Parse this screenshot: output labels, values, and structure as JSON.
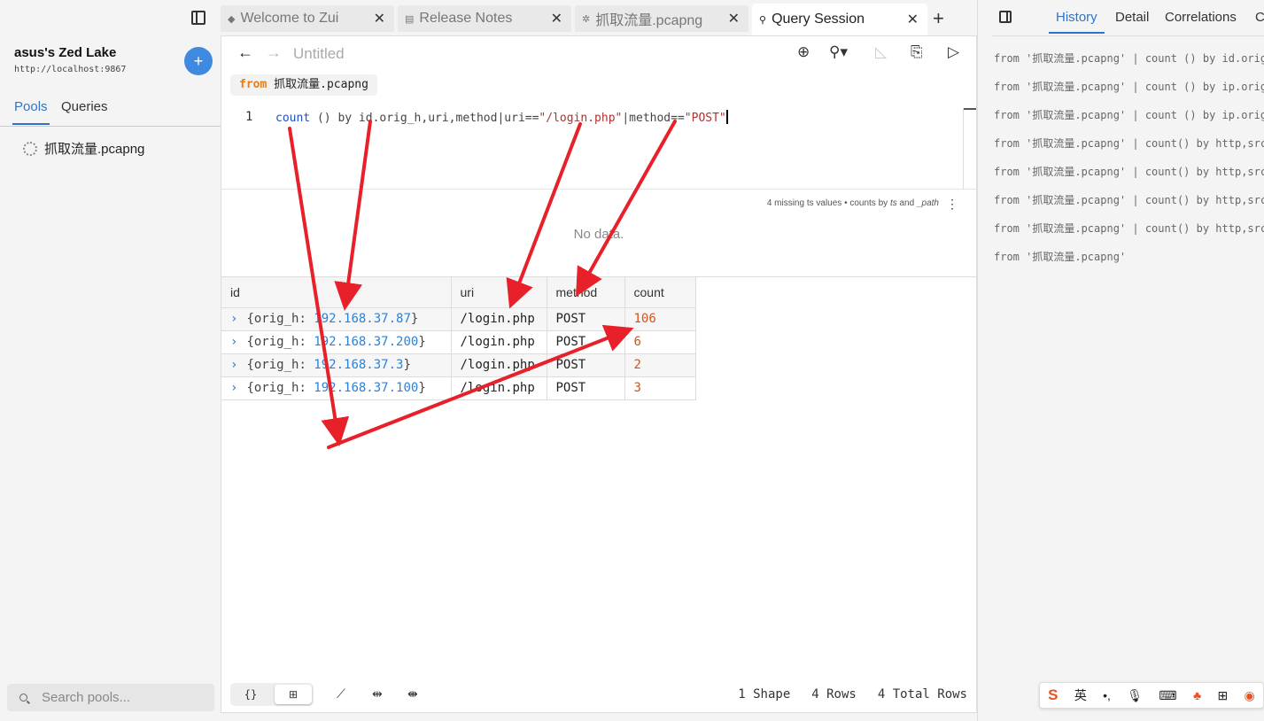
{
  "sidebar": {
    "lake_name": "asus's Zed Lake",
    "lake_url": "http://localhost:9867",
    "add_label": "+",
    "tabs": [
      "Pools",
      "Queries"
    ],
    "pools": [
      "抓取流量.pcapng"
    ],
    "search_placeholder": "Search pools..."
  },
  "tabs": [
    {
      "icon": "◆",
      "label": "Welcome to Zui"
    },
    {
      "icon": "▤",
      "label": "Release Notes"
    },
    {
      "icon": "✲",
      "label": "抓取流量.pcapng"
    },
    {
      "icon": "⚲",
      "label": "Query Session",
      "active": true
    }
  ],
  "query": {
    "title": "Untitled",
    "from_keyword": "from",
    "from_pool": "抓取流量.pcapng",
    "line_number": "1",
    "code_fn": "count",
    "code_mid": " () by id.orig_h,uri,method|uri==",
    "code_str1": "\"/login.php\"",
    "code_mid2": "|method==",
    "code_str2": "\"POST\""
  },
  "chart": {
    "info_prefix": "4 missing ts values • counts by ",
    "info_ts": "ts",
    "info_and": " and ",
    "info_path": "_path",
    "empty_text": "No data."
  },
  "table": {
    "columns": [
      "id",
      "uri",
      "method",
      "count"
    ],
    "rows": [
      {
        "prefix": "{orig_h: ",
        "ip": "192.168.37.87",
        "suffix": "}",
        "uri": "/login.php",
        "method": "POST",
        "count": "106"
      },
      {
        "prefix": "{orig_h: ",
        "ip": "192.168.37.200",
        "suffix": "}",
        "uri": "/login.php",
        "method": "POST",
        "count": "6"
      },
      {
        "prefix": "{orig_h: ",
        "ip": "192.168.37.3",
        "suffix": "}",
        "uri": "/login.php",
        "method": "POST",
        "count": "2"
      },
      {
        "prefix": "{orig_h: ",
        "ip": "192.168.37.100",
        "suffix": "}",
        "uri": "/login.php",
        "method": "POST",
        "count": "3"
      }
    ]
  },
  "bottom": {
    "view_json": "{}",
    "view_table": "⊞",
    "shape": "1 Shape",
    "rows": "4 Rows",
    "total_rows": "4 Total Rows"
  },
  "right_panel": {
    "tabs": [
      "History",
      "Detail",
      "Correlations",
      "C"
    ],
    "history": [
      "from '抓取流量.pcapng' | count () by id.orig_h",
      "from '抓取流量.pcapng' | count () by ip.orig_h",
      "from '抓取流量.pcapng' | count () by ip.orig_h",
      "from '抓取流量.pcapng' | count() by http,src",
      "from '抓取流量.pcapng' | count() by http,src",
      "from '抓取流量.pcapng' | count() by http,src",
      "from '抓取流量.pcapng' | count() by http,src",
      "from '抓取流量.pcapng'"
    ]
  },
  "ime": {
    "logo": "S",
    "lang": "英"
  },
  "colors": {
    "accent": "#2f74c8",
    "ip": "#2b82d9",
    "count": "#d2531f",
    "annotation_arrow": "#e8202a"
  }
}
